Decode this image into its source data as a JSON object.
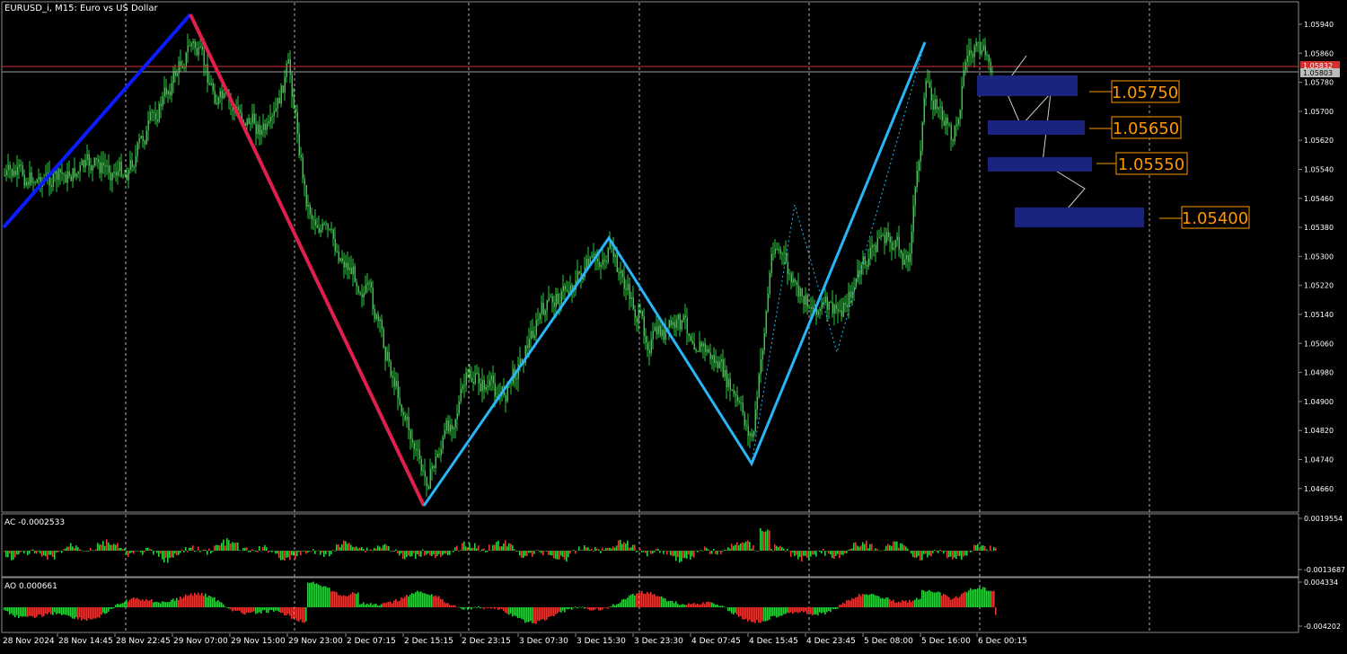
{
  "main_panel": {
    "title": "EURUSD_i, M15:  Euro vs US Dollar",
    "price_labels": [
      "1.05940",
      "1.05860",
      "1.05780",
      "1.05700",
      "1.05620",
      "1.05540",
      "1.05460",
      "1.05380",
      "1.05300",
      "1.05220",
      "1.05140",
      "1.05060",
      "1.04980",
      "1.04900",
      "1.04820",
      "1.04740",
      "1.04660"
    ],
    "bid_badge": "1.05832",
    "ask_badge": "1.05803"
  },
  "targets": [
    {
      "label": "1.05750",
      "price": 1.0575
    },
    {
      "label": "1.05650",
      "price": 1.0565
    },
    {
      "label": "1.05550",
      "price": 1.0555
    },
    {
      "label": "1.05400",
      "price": 1.054
    }
  ],
  "ac_panel": {
    "title": "AC -0.0002533",
    "scale_top": "0.0019554",
    "scale_bottom": "-0.0013687"
  },
  "ao_panel": {
    "title": "AO 0.000661",
    "scale_top": "0.004334",
    "scale_bottom": "-0.004202"
  },
  "time_axis": [
    "28 Nov 2024",
    "28 Nov 14:45",
    "28 Nov 22:45",
    "29 Nov 07:00",
    "29 Nov 15:00",
    "29 Nov 23:00",
    "2 Dec 07:15",
    "2 Dec 15:15",
    "2 Dec 23:15",
    "3 Dec 07:30",
    "3 Dec 15:30",
    "3 Dec 23:30",
    "4 Dec 07:45",
    "4 Dec 15:45",
    "4 Dec 23:45",
    "5 Dec 08:00",
    "5 Dec 16:00",
    "6 Dec 00:15"
  ],
  "colors": {
    "background": "#000000",
    "candles": "#2ecc40",
    "grid": "#c0c0c0",
    "zigzag_up": "#0a1cff",
    "zigzag_down": "#e0204a",
    "zigzag_light": "#29b6f6",
    "target_box": "#1a237e",
    "target_border": "#ff9800",
    "target_text": "#ff9800",
    "bid_line": "#d32f2f",
    "ask_line": "#9e9e9e",
    "hist_up": "#2ecc40",
    "hist_down": "#e53935"
  }
}
